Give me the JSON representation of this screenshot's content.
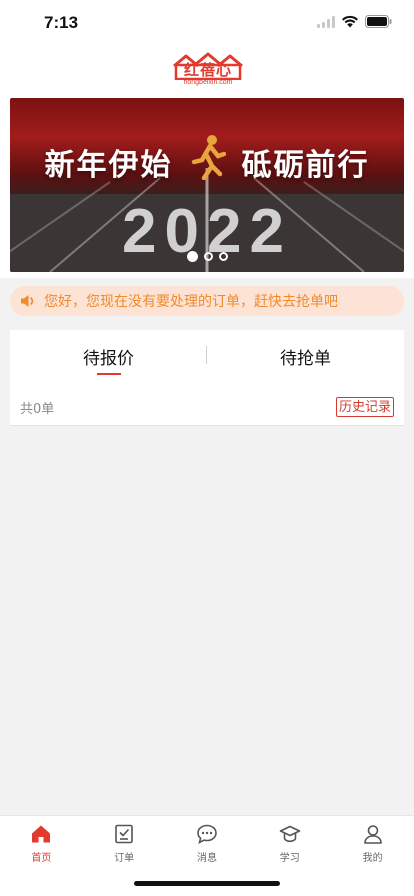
{
  "status_bar": {
    "time": "7:13"
  },
  "header": {
    "logo_text": "红蓓心",
    "logo_sub": "hongbeixin.com"
  },
  "banner": {
    "slogan_left": "新年伊始",
    "slogan_right": "砥砺前行",
    "year": "2022",
    "slide_count": 3,
    "active_slide": 1
  },
  "notice": {
    "text": "您好，您现在没有要处理的订单，赶快去抢单吧"
  },
  "tabs": {
    "items": [
      {
        "label": "待报价"
      },
      {
        "label": "待抢单"
      }
    ],
    "active": 0
  },
  "list": {
    "count_text": "共0单",
    "history_label": "历史记录"
  },
  "tabbar": {
    "items": [
      {
        "label": "首页",
        "icon": "home-icon"
      },
      {
        "label": "订单",
        "icon": "order-icon"
      },
      {
        "label": "消息",
        "icon": "message-icon"
      },
      {
        "label": "学习",
        "icon": "study-icon"
      },
      {
        "label": "我的",
        "icon": "profile-icon"
      }
    ],
    "active": 0
  },
  "colors": {
    "accent": "#e23a2e",
    "notice_bg": "#fde3d6",
    "notice_text": "#f08b2a",
    "page_bg": "#f2f2f2"
  }
}
